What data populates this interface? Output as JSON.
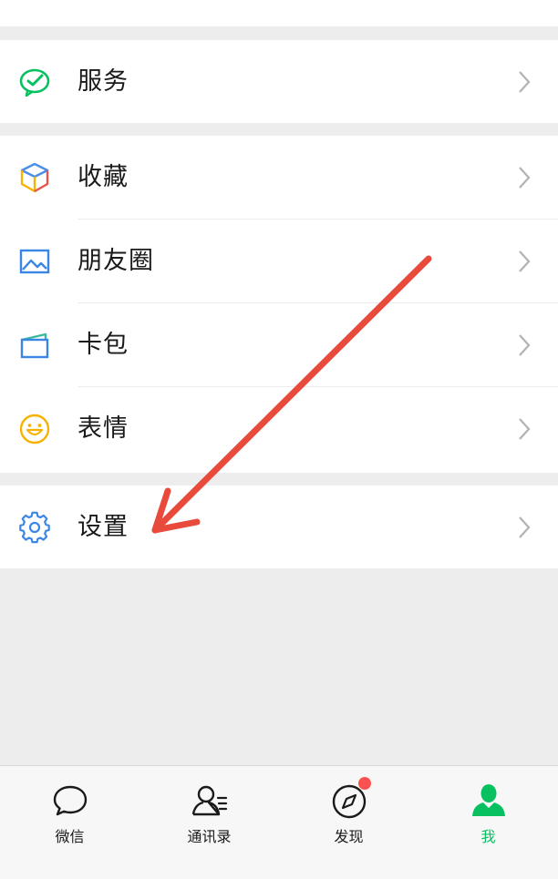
{
  "menu": {
    "service": {
      "label": "服务",
      "icon": "wechat-pay-icon"
    },
    "favorites": {
      "label": "收藏",
      "icon": "cube-icon"
    },
    "moments": {
      "label": "朋友圈",
      "icon": "image-icon"
    },
    "cards": {
      "label": "卡包",
      "icon": "card-wallet-icon"
    },
    "stickers": {
      "label": "表情",
      "icon": "smiley-icon"
    },
    "settings": {
      "label": "设置",
      "icon": "gear-icon"
    }
  },
  "tabbar": {
    "chats": {
      "label": "微信",
      "icon": "chat-bubble-icon"
    },
    "contacts": {
      "label": "通讯录",
      "icon": "contacts-icon"
    },
    "discover": {
      "label": "发现",
      "icon": "compass-icon",
      "has_badge": true
    },
    "me": {
      "label": "我",
      "icon": "person-icon",
      "active": true
    }
  },
  "colors": {
    "brand_green": "#07c160",
    "badge_red": "#fa5151",
    "annotation_arrow": "#e84a3c",
    "background": "#ededed"
  }
}
